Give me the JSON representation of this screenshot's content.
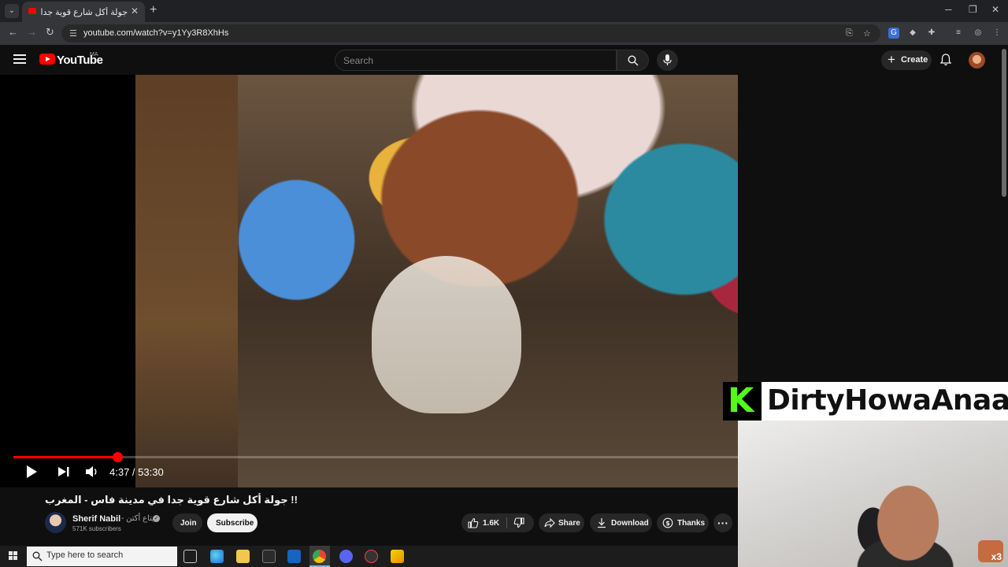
{
  "browser": {
    "tab_title": "جولة أكل شارع قوية جدا في مدينة فاس - المغرب",
    "url": "youtube.com/watch?v=y1Yy3R8XhHs",
    "tab_close": "✕",
    "new_tab": "+",
    "window_controls": [
      "─",
      "❐",
      "✕"
    ],
    "nav": {
      "back": "←",
      "forward": "→",
      "reload": "↻"
    }
  },
  "youtube": {
    "wordmark": "YouTube",
    "country_code": "MA",
    "search_placeholder": "Search",
    "create_label": "Create",
    "create_plus": "+"
  },
  "player": {
    "current_time": "4:37",
    "duration": "53:30",
    "time_text": "4:37 / 53:30",
    "progress_fraction": 0.1438,
    "buffered_fraction": 0.135
  },
  "overlay": {
    "logo_letter": "K",
    "channel_name": "DirtyHowaAnaa",
    "badge_text": "x3"
  },
  "video": {
    "title": "!! جولة أكل شارع قوية جدا في مدينة فاس - المغرب",
    "channel_name": "Sherif Nabil",
    "channel_alt": "- يتاع أكتن",
    "subscribers": "571K subscribers",
    "join_label": "Join",
    "subscribe_label": "Subscribe",
    "like_count": "1.6K",
    "share_label": "Share",
    "download_label": "Download",
    "thanks_label": "Thanks",
    "more_label": "···"
  },
  "taskbar": {
    "search_placeholder": "Type here to search"
  },
  "colors": {
    "yt_red": "#ff0000",
    "kick_green": "#53fc18",
    "background": "#0f0f0f"
  }
}
